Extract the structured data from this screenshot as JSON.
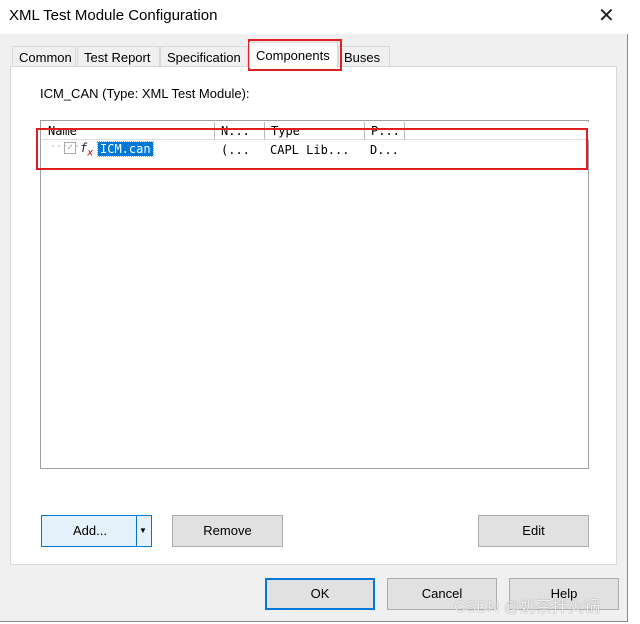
{
  "window": {
    "title": "XML Test Module Configuration",
    "close_icon": "close-icon"
  },
  "tabs": [
    {
      "label": "Common"
    },
    {
      "label": "Test Report"
    },
    {
      "label": "Specification"
    },
    {
      "label": "Components",
      "active": true
    },
    {
      "label": "Buses"
    }
  ],
  "module_label": "ICM_CAN (Type: XML Test Module):",
  "list": {
    "columns": [
      "Name",
      "N...",
      "Type",
      "P..."
    ],
    "rows": [
      {
        "name": "ICM.can",
        "n": "(...",
        "type": "CAPL Lib...",
        "p": "D...",
        "checked": true,
        "selected": true
      }
    ]
  },
  "buttons": {
    "add": "Add...",
    "remove": "Remove",
    "edit": "Edit",
    "ok": "OK",
    "cancel": "Cancel",
    "help": "Help"
  },
  "watermark": "CSDN @奶茶拌火锅",
  "colors": {
    "highlight": "#e02020",
    "selection": "#0078d7"
  }
}
